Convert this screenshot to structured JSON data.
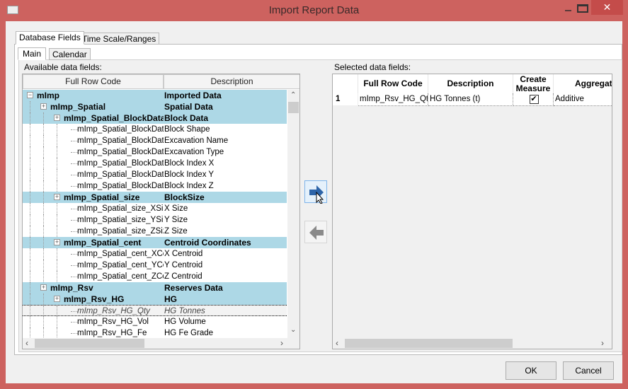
{
  "window": {
    "title": "Import Report Data",
    "icon": "chart-grid-icon",
    "minimize": "minimize-icon",
    "maximize": "maximize-icon",
    "close": "✕"
  },
  "tabs": {
    "outer": [
      "Database Fields",
      "Time Scale/Ranges"
    ],
    "inner": [
      "Main",
      "Calendar"
    ]
  },
  "available": {
    "label": "Available data fields:",
    "columns": [
      "Full Row Code",
      "Description"
    ],
    "rows": [
      {
        "level": 0,
        "type": "group",
        "code": "mImp",
        "desc": "Imported Data"
      },
      {
        "level": 1,
        "type": "group",
        "code": "mImp_Spatial",
        "desc": "Spatial Data"
      },
      {
        "level": 2,
        "type": "group",
        "code": "mImp_Spatial_BlockData",
        "desc": "Block Data"
      },
      {
        "level": 3,
        "type": "leaf",
        "code": "mImp_Spatial_BlockData",
        "desc": "Block Shape"
      },
      {
        "level": 3,
        "type": "leaf",
        "code": "mImp_Spatial_BlockData",
        "desc": "Excavation Name"
      },
      {
        "level": 3,
        "type": "leaf",
        "code": "mImp_Spatial_BlockData",
        "desc": "Excavation Type"
      },
      {
        "level": 3,
        "type": "leaf",
        "code": "mImp_Spatial_BlockData",
        "desc": "Block Index X"
      },
      {
        "level": 3,
        "type": "leaf",
        "code": "mImp_Spatial_BlockData",
        "desc": "Block Index Y"
      },
      {
        "level": 3,
        "type": "leaf",
        "code": "mImp_Spatial_BlockData",
        "desc": "Block Index Z"
      },
      {
        "level": 2,
        "type": "group",
        "code": "mImp_Spatial_size",
        "desc": "BlockSize"
      },
      {
        "level": 3,
        "type": "leaf",
        "code": "mImp_Spatial_size_XSize",
        "desc": "X Size"
      },
      {
        "level": 3,
        "type": "leaf",
        "code": "mImp_Spatial_size_YSize",
        "desc": "Y Size"
      },
      {
        "level": 3,
        "type": "leaf",
        "code": "mImp_Spatial_size_ZSize",
        "desc": "Z Size"
      },
      {
        "level": 2,
        "type": "group",
        "code": "mImp_Spatial_cent",
        "desc": "Centroid Coordinates"
      },
      {
        "level": 3,
        "type": "leaf",
        "code": "mImp_Spatial_cent_XCent",
        "desc": "X Centroid"
      },
      {
        "level": 3,
        "type": "leaf",
        "code": "mImp_Spatial_cent_YCent",
        "desc": "Y Centroid"
      },
      {
        "level": 3,
        "type": "leaf",
        "code": "mImp_Spatial_cent_ZCent",
        "desc": "Z Centroid"
      },
      {
        "level": 1,
        "type": "group",
        "code": "mImp_Rsv",
        "desc": "Reserves Data"
      },
      {
        "level": 2,
        "type": "group",
        "code": "mImp_Rsv_HG",
        "desc": "HG"
      },
      {
        "level": 3,
        "type": "selected",
        "code": "mImp_Rsv_HG_Qty",
        "desc": "HG Tonnes"
      },
      {
        "level": 3,
        "type": "leaf",
        "code": "mImp_Rsv_HG_Vol",
        "desc": "HG Volume"
      },
      {
        "level": 3,
        "type": "leaf",
        "code": "mImp_Rsv_HG_Fe",
        "desc": "HG Fe Grade"
      }
    ]
  },
  "transfer": {
    "add": "arrow-right-icon",
    "remove": "arrow-left-icon"
  },
  "selected": {
    "label": "Selected data fields:",
    "columns": [
      "",
      "Full Row Code",
      "Description",
      "Create Measure",
      "Aggregation Type"
    ],
    "rows": [
      {
        "num": "1",
        "code": "mImp_Rsv_HG_Qty",
        "desc": "HG Tonnes (t)",
        "create_measure": true,
        "aggregation": "Additive"
      }
    ]
  },
  "buttons": {
    "ok": "OK",
    "cancel": "Cancel"
  }
}
